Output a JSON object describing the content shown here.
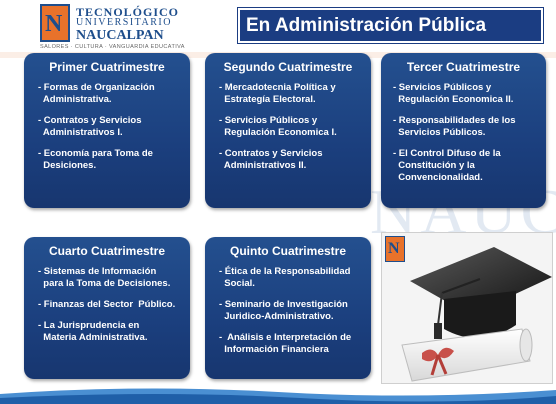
{
  "header": {
    "logo": {
      "mark": "N",
      "line1": "TECNOLÓGICO",
      "line2": "UNIVERSITARIO",
      "line3": "NAUCALPAN",
      "tagline": "SALORES · CULTURA · VANGUARDIA EDUCATIVA"
    },
    "title": "En Administración Pública"
  },
  "watermark": "NAUCA",
  "cards": [
    {
      "title": "Primer Cuatrimestre",
      "items": [
        "- Formas de Organización\n  Administrativa.",
        "- Contratos y Servicios\n  Administrativos I.",
        "- Economía para Toma de\n  Desiciones."
      ]
    },
    {
      "title": "Segundo Cuatrimestre",
      "items": [
        "- Mercadotecnia Política y\n  Estrategía Electoral.",
        "- Servicios Públicos y\n  Regulación Economica I.",
        "- Contratos y Servicios\n  Administrativos II."
      ]
    },
    {
      "title": "Tercer Cuatrimestre",
      "items": [
        "- Servicios Públicos y\n  Regulación Economica II.",
        "- Responsabilidades de los\n  Servicios Públicos.",
        "- El Control Difuso de la\n  Constitución y la\n  Convencionalidad."
      ]
    },
    {
      "title": "Cuarto Cuatrimestre",
      "items": [
        "- Sistemas de Información\n  para la Toma de Decisiones.",
        "- Finanzas del Sector  Público.",
        "- La Jurisprudencia en\n  Materia Administrativa."
      ]
    },
    {
      "title": "Quinto Cuatrimestre",
      "items": [
        "- Ética de la Responsabilidad\n  Social.",
        "- Seminario de Investigación\n  Juridico-Administrativo.",
        "-  Análisis e Interpretación de\n  Información Financiera"
      ]
    }
  ],
  "photo": {
    "logo_mark": "N",
    "icon": "graduation-cap-diploma-icon"
  },
  "colors": {
    "card": "#1b3f7e",
    "title_bg": "#1b3d82",
    "accent": "#e8722b"
  }
}
